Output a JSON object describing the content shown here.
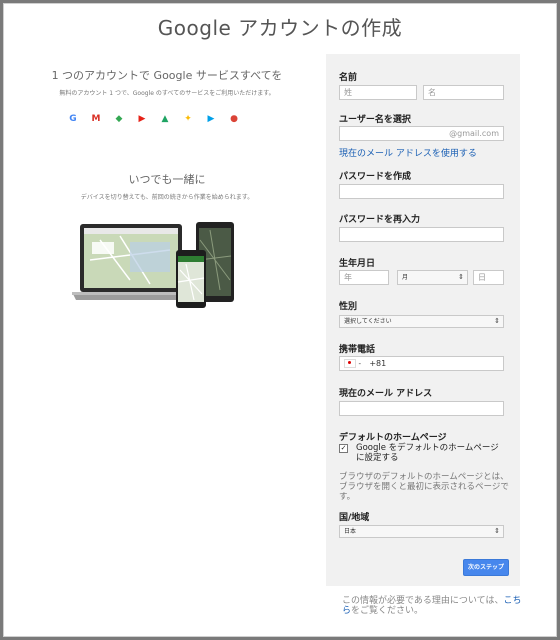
{
  "page_title": "Google アカウントの作成",
  "left": {
    "heading": "1 つのアカウントで Google サービスすべてを",
    "subtext": "無料のアカウント 1 つで、Google のすべてのサービスをご利用いただけます。",
    "services": [
      {
        "name": "google-g-icon",
        "glyph": "G",
        "color": "#4285f4"
      },
      {
        "name": "gmail-icon",
        "glyph": "M",
        "color": "#d93025"
      },
      {
        "name": "maps-icon",
        "glyph": "◆",
        "color": "#34a853"
      },
      {
        "name": "youtube-icon",
        "glyph": "▶",
        "color": "#e62117"
      },
      {
        "name": "drive-icon",
        "glyph": "▲",
        "color": "#1fa463"
      },
      {
        "name": "photos-icon",
        "glyph": "✦",
        "color": "#fbbc05"
      },
      {
        "name": "play-icon",
        "glyph": "▶",
        "color": "#00a0e9"
      },
      {
        "name": "chrome-icon",
        "glyph": "●",
        "color": "#db4437"
      }
    ],
    "heading2": "いつでも一緒に",
    "subtext2": "デバイスを切り替えても、前回の続きから作業を始められます。"
  },
  "form": {
    "name_label": "名前",
    "last_name_placeholder": "姓",
    "first_name_placeholder": "名",
    "username_label": "ユーザー名を選択",
    "username_suffix": "@gmail.com",
    "use_current_email_link": "現在のメール アドレスを使用する",
    "password_label": "パスワードを作成",
    "password_confirm_label": "パスワードを再入力",
    "birthday_label": "生年月日",
    "year_placeholder": "年",
    "month_value": "月",
    "day_placeholder": "日",
    "gender_label": "性別",
    "gender_value": "選択してください",
    "phone_label": "携帯電話",
    "phone_country_code": "+81",
    "current_email_label": "現在のメール アドレス",
    "homepage_label": "デフォルトのホームページ",
    "homepage_checkbox_label": "Google をデフォルトのホームページに設定する",
    "homepage_checked": true,
    "homepage_note": "ブラウザのデフォルトのホームページとは、ブラウザを開くと最初に表示されるページです。",
    "country_label": "国/地域",
    "country_value": "日本",
    "next_button": "次のステップ"
  },
  "footer": {
    "text_before": "この情報が必要である理由については、",
    "link": "こちら",
    "text_after": "をご覧ください。"
  }
}
